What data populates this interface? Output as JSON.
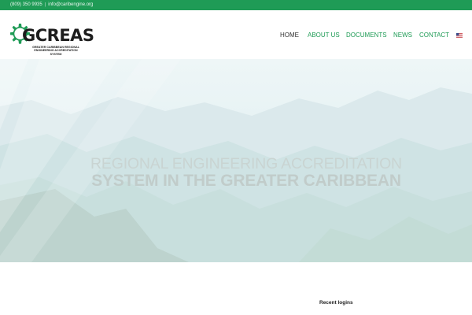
{
  "topbar": {
    "phone": "(809) 350 9935",
    "separator": "|",
    "email": "info@caribengine.org"
  },
  "logo": {
    "name": "GCREAS",
    "subtitle_line1": "GREATER CARIBBEAN REGIONAL",
    "subtitle_line2": "ENGINEERING ACCREDITATION SYSTEM"
  },
  "nav": {
    "home": "HOME",
    "about": "ABOUT US",
    "documents": "DOCUMENTS",
    "news": "NEWS",
    "contact": "CONTACT"
  },
  "hero": {
    "line1": "REGIONAL ENGINEERING ACCREDITATION",
    "line2": "SYSTEM IN THE GREATER CARIBBEAN"
  },
  "sidebar": {
    "recent_title": "Recent logins"
  },
  "colors": {
    "brand_green": "#1f9b56",
    "nav_active": "#333333"
  },
  "icons": {
    "gear": "gear-icon",
    "flag": "us-flag-icon"
  }
}
